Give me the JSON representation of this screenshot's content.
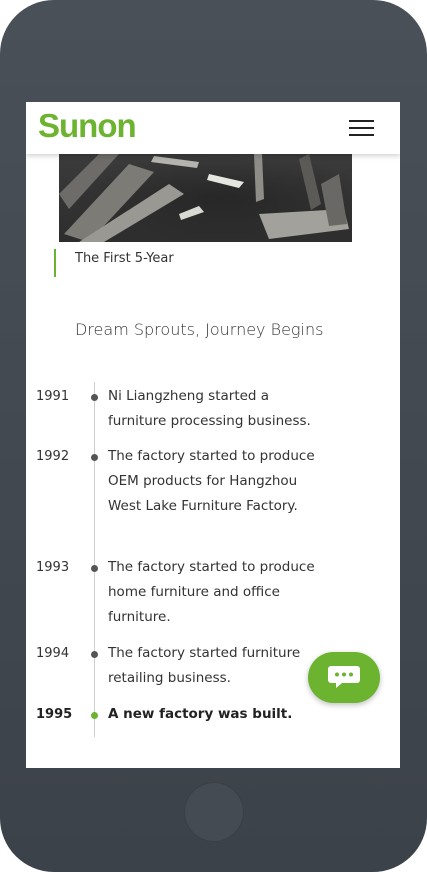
{
  "header": {
    "logo_text": "Sunon"
  },
  "hero": {
    "caption": "The First 5-Year"
  },
  "section": {
    "title": "Dream Sprouts, Journey Begins"
  },
  "timeline": [
    {
      "year": "1991",
      "text": "Ni Liangzheng started a furniture processing business."
    },
    {
      "year": "1992",
      "text": "The factory started to produce OEM products for Hangzhou West Lake Furniture Factory."
    },
    {
      "year": "1993",
      "text": "The factory started to produce home furniture and office furniture."
    },
    {
      "year": "1994",
      "text": "The factory started furniture retailing business."
    },
    {
      "year": "1995",
      "text": "A new factory was built."
    }
  ],
  "colors": {
    "brand_green": "#6cb330",
    "frame": "#41474e"
  },
  "icons": {
    "menu": "hamburger-menu-icon",
    "chat": "chat-bubble-icon"
  }
}
